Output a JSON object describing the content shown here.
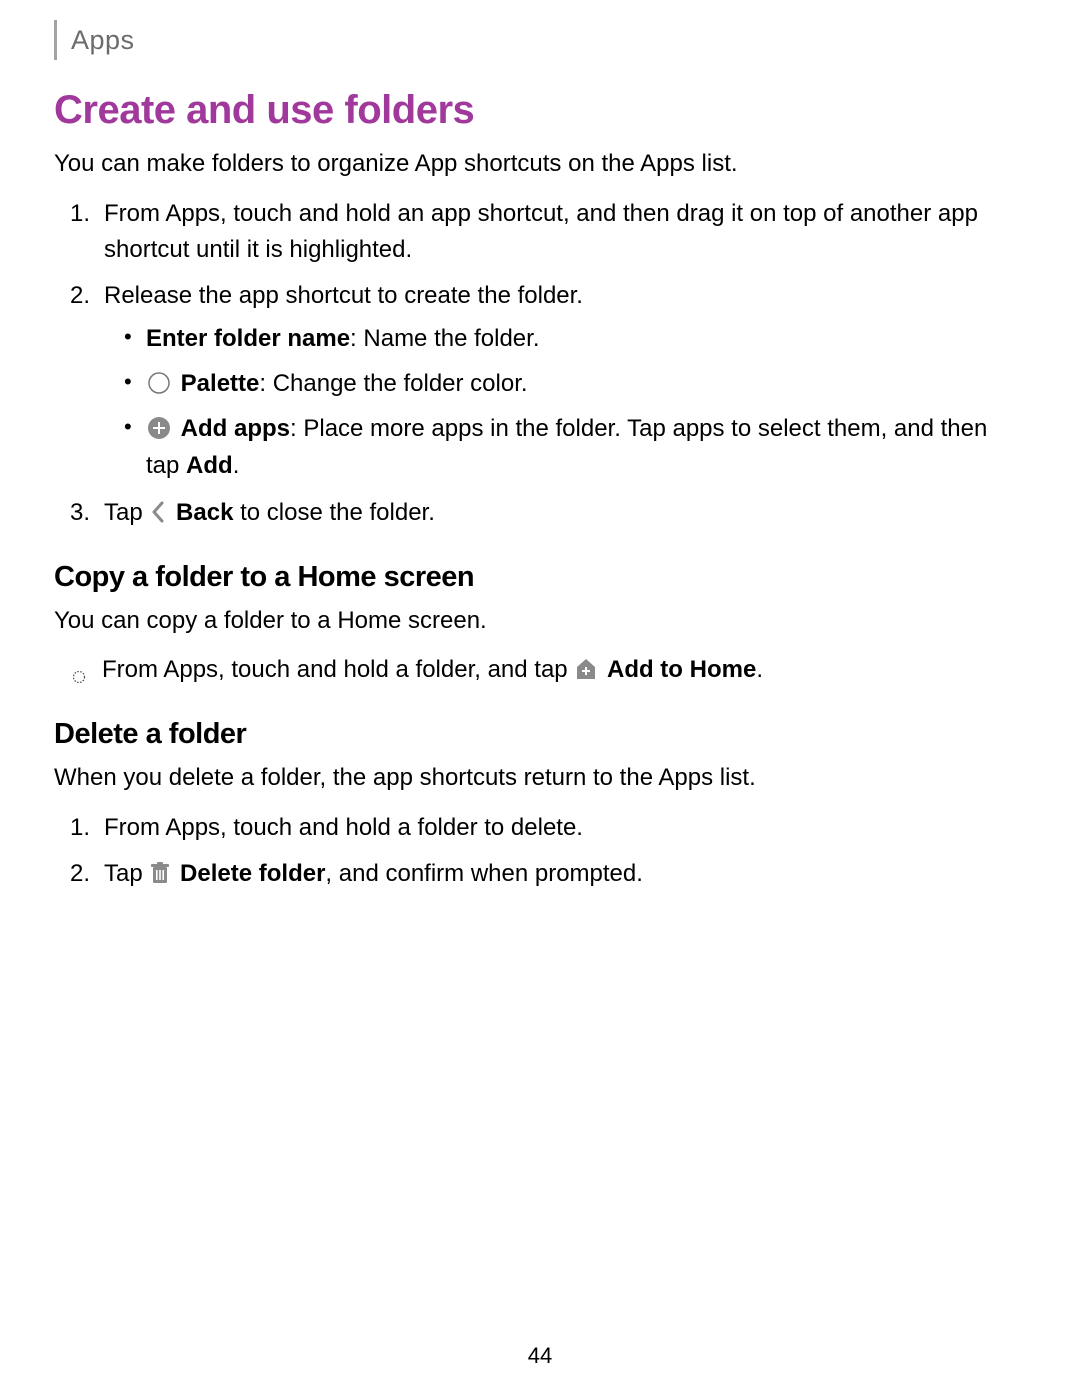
{
  "header": {
    "section": "Apps"
  },
  "h1": "Create and use folders",
  "intro": "You can make folders to organize App shortcuts on the Apps list.",
  "steps": {
    "s1": {
      "num": "1.",
      "text": "From Apps, touch and hold an app shortcut, and then drag it on top of another app shortcut until it is highlighted."
    },
    "s2": {
      "num": "2.",
      "text": "Release the app shortcut to create the folder.",
      "sub": {
        "a": {
          "bold": "Enter folder name",
          "rest": ": Name the folder."
        },
        "b": {
          "bold": "Palette",
          "rest": ": Change the folder color."
        },
        "c": {
          "bold": "Add apps",
          "rest_before": ": Place more apps in the folder. Tap apps to select them, and then tap ",
          "rest_bold_tail": "Add",
          "rest_after": "."
        }
      }
    },
    "s3": {
      "num": "3.",
      "lead": "Tap ",
      "bold": "Back",
      "rest": " to close the folder."
    }
  },
  "copy": {
    "h2": "Copy a folder to a Home screen",
    "intro": "You can copy a folder to a Home screen.",
    "line": {
      "lead": "From Apps, touch and hold a folder, and tap ",
      "bold": "Add to Home",
      "tail": "."
    }
  },
  "delete": {
    "h2": "Delete a folder",
    "intro": "When you delete a folder, the app shortcuts return to the Apps list.",
    "s1": {
      "num": "1.",
      "text": "From Apps, touch and hold a folder to delete."
    },
    "s2": {
      "num": "2.",
      "lead": "Tap ",
      "bold": "Delete folder",
      "rest": ", and confirm when prompted."
    }
  },
  "page_number": "44"
}
